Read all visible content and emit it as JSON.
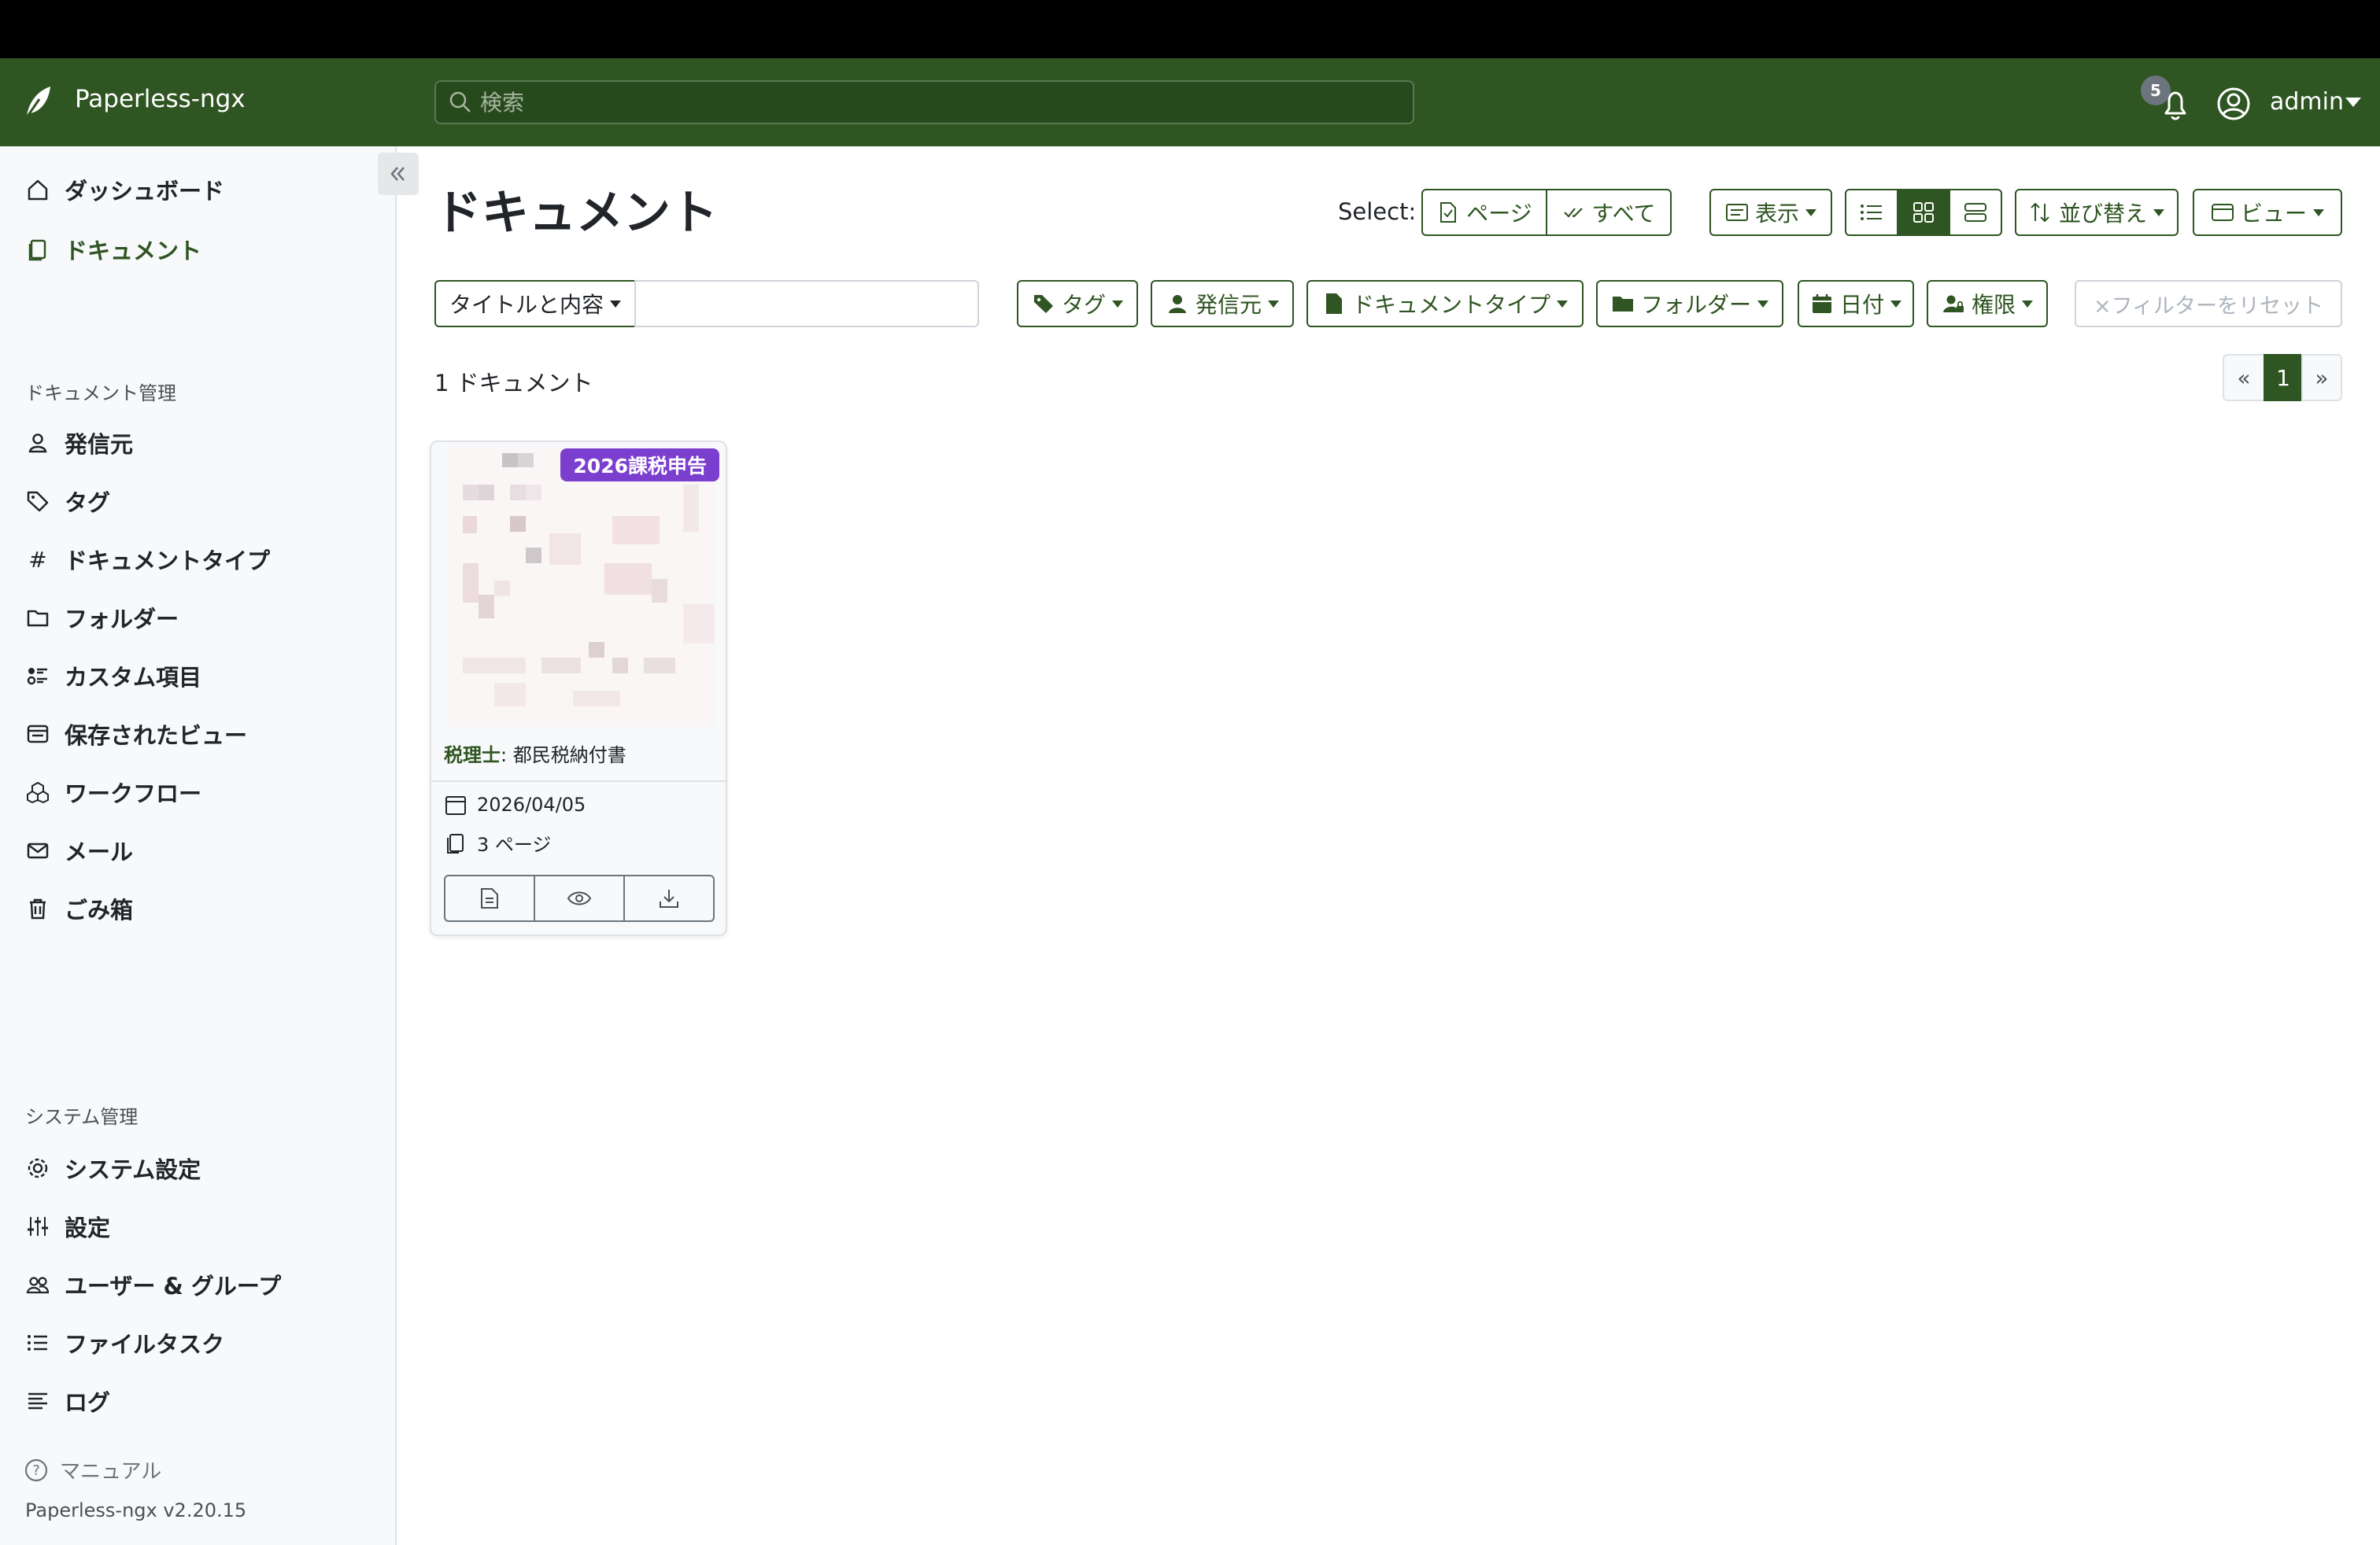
{
  "header": {
    "app_name": "Paperless-ngx",
    "search_placeholder": "検索",
    "notification_count": "5",
    "user_name": "admin"
  },
  "sidebar": {
    "items": [
      {
        "label": "ダッシュボード",
        "icon": "house-icon"
      },
      {
        "label": "ドキュメント",
        "icon": "files-icon"
      }
    ],
    "management_title": "ドキュメント管理",
    "management_items": [
      {
        "label": "発信元",
        "icon": "person-icon"
      },
      {
        "label": "タグ",
        "icon": "tags-icon"
      },
      {
        "label": "ドキュメントタイプ",
        "icon": "hash-icon"
      },
      {
        "label": "フォルダー",
        "icon": "folder-icon"
      },
      {
        "label": "カスタム項目",
        "icon": "ui-radios-icon"
      },
      {
        "label": "保存されたビュー",
        "icon": "view-icon"
      },
      {
        "label": "ワークフロー",
        "icon": "boxes-icon"
      },
      {
        "label": "メール",
        "icon": "envelope-icon"
      },
      {
        "label": "ごみ箱",
        "icon": "trash-icon"
      }
    ],
    "system_title": "システム管理",
    "system_items": [
      {
        "label": "システム設定",
        "icon": "gear-icon"
      },
      {
        "label": "設定",
        "icon": "sliders-icon"
      },
      {
        "label": "ユーザー & グループ",
        "icon": "people-icon"
      },
      {
        "label": "ファイルタスク",
        "icon": "list-task-icon"
      },
      {
        "label": "ログ",
        "icon": "text-left-icon"
      }
    ],
    "manual": "マニュアル",
    "version": "Paperless-ngx v2.20.15"
  },
  "main": {
    "title": "ドキュメント",
    "select_label": "Select:",
    "select_page": "ページ",
    "select_all": "すべて",
    "display": "表示",
    "sort": "並び替え",
    "views": "ビュー",
    "filter_field": "タイトルと内容",
    "filter_value": "",
    "filters": {
      "tags": "タグ",
      "correspondent": "発信元",
      "doc_type": "ドキュメントタイプ",
      "folder": "フォルダー",
      "date": "日付",
      "permissions": "権限",
      "reset": "×フィルターをリセット"
    },
    "doc_count": "1 ドキュメント",
    "pagination": {
      "prev": "«",
      "current": "1",
      "next": "»"
    }
  },
  "documents": [
    {
      "tag": "2026課税申告",
      "correspondent": "税理士",
      "title": ": 都民税納付書",
      "date": "2026/04/05",
      "pages": "3 ページ"
    }
  ],
  "colors": {
    "brand": "#2e5522",
    "tag": "#7b3fcf"
  }
}
